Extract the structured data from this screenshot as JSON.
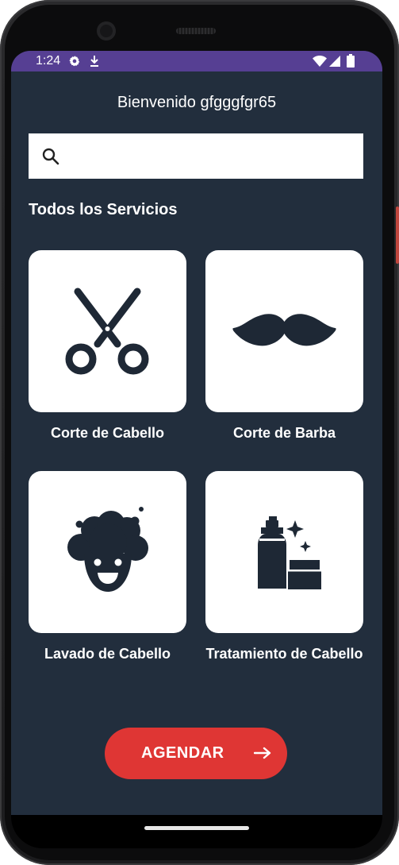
{
  "status_bar": {
    "time": "1:24",
    "icons": [
      "settings-gear-icon",
      "download-icon",
      "wifi-icon",
      "signal-icon",
      "battery-icon"
    ]
  },
  "header": {
    "greeting": "Bienvenido gfgggfgr65"
  },
  "search": {
    "placeholder": "",
    "value": ""
  },
  "section": {
    "title": "Todos los Servicios"
  },
  "services": [
    {
      "label": "Corte de Cabello",
      "icon": "scissors-icon"
    },
    {
      "label": "Corte de Barba",
      "icon": "mustache-icon"
    },
    {
      "label": "Lavado de Cabello",
      "icon": "hair-wash-icon"
    },
    {
      "label": "Tratamiento de Cabello",
      "icon": "hair-treatment-icon"
    }
  ],
  "cta": {
    "label": "AGENDAR",
    "icon": "arrow-right-icon"
  },
  "colors": {
    "background": "#222e3d",
    "status_bar": "#563f93",
    "accent": "#df3634",
    "icon_dark": "#1e2835"
  }
}
